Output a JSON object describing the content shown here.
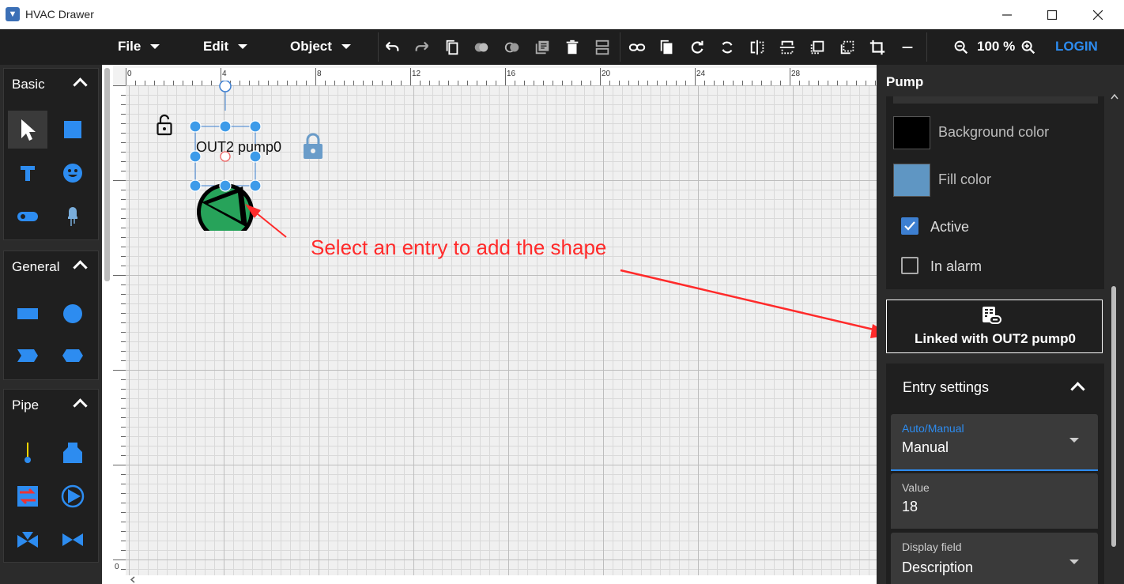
{
  "window": {
    "title": "HVAC Drawer",
    "app_icon": "app-logo-icon"
  },
  "menu": {
    "file": "File",
    "edit": "Edit",
    "object": "Object"
  },
  "toolbar": {
    "zoom": "100 %",
    "login": "LOGIN"
  },
  "left_panel": {
    "sections": [
      {
        "title": "Basic"
      },
      {
        "title": "General"
      },
      {
        "title": "Pipe"
      }
    ]
  },
  "canvas": {
    "ruler_labels": [
      "0",
      "4",
      "8",
      "12",
      "16",
      "20",
      "24",
      "28"
    ],
    "vertical_ruler_label": "0",
    "shape_label": "OUT2 pump0",
    "annotation": "Select an entry to add the shape"
  },
  "right_panel": {
    "title": "Pump",
    "background_color_label": "Background color",
    "background_color": "#000000",
    "fill_color_label": "Fill color",
    "fill_color": "#5f96c3",
    "active_label": "Active",
    "active_checked": true,
    "in_alarm_label": "In alarm",
    "in_alarm_checked": false,
    "linked_text": "Linked with OUT2 pump0",
    "entry_settings_title": "Entry settings",
    "auto_manual_label": "Auto/Manual",
    "auto_manual_value": "Manual",
    "value_label": "Value",
    "value_value": "18",
    "display_field_label": "Display field",
    "display_field_value": "Description"
  },
  "colors": {
    "accent": "#2d8cf0",
    "toolbar_bg": "#1e1e1e",
    "panel_bg": "#2b2b2b",
    "annotation": "#ff2a2a",
    "pump_green": "#27a35a"
  }
}
